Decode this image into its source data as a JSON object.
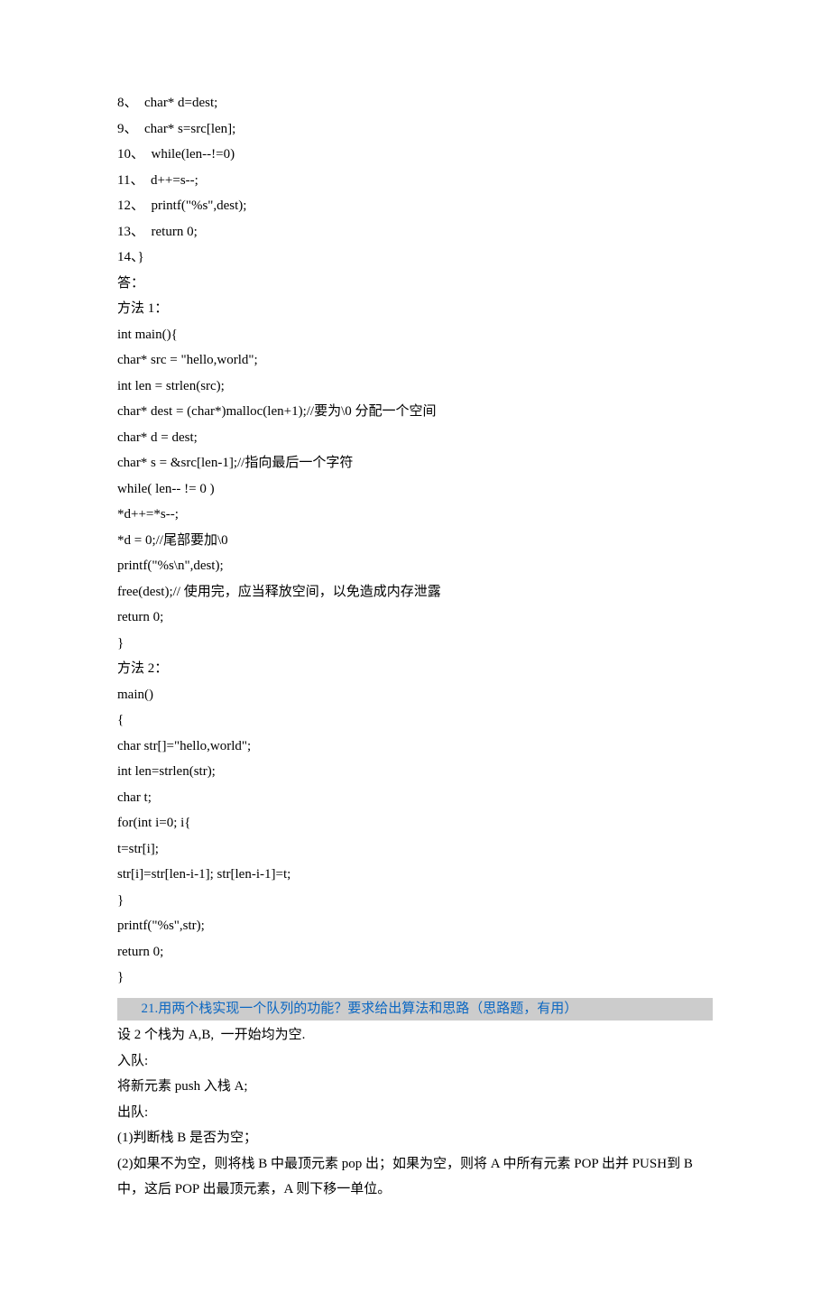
{
  "lines": [
    "8、  char* d=dest;",
    "9、  char* s=src[len];",
    "10、  while(len--!=0)",
    "11、  d++=s--;",
    "12、  printf(\"%s\",dest);",
    "13、  return 0;",
    "14、}",
    "答：",
    "方法 1：",
    "int main(){",
    "char* src = \"hello,world\";",
    "int len = strlen(src);",
    "char* dest = (char*)malloc(len+1);//要为\\0 分配一个空间",
    "char* d = dest;",
    "char* s = &src[len-1];//指向最后一个字符",
    "while( len-- != 0 )",
    "*d++=*s--;",
    "*d = 0;//尾部要加\\0",
    "printf(\"%s\\n\",dest);",
    "free(dest);// 使用完，应当释放空间，以免造成内存泄露",
    "return 0;",
    "}",
    "方法 2：",
    "main()",
    "{",
    "char str[]=\"hello,world\";",
    "int len=strlen(str);",
    "char t;",
    "for(int i=0; i{",
    "t=str[i];",
    "str[i]=str[len-i-1]; str[len-i-1]=t;",
    "}",
    "printf(\"%s\",str);",
    "return 0;",
    "}"
  ],
  "heading": "21.用两个栈实现一个队列的功能？要求给出算法和思路（思路题，有用）",
  "after": [
    "设 2 个栈为 A,B,  一开始均为空.",
    "入队:",
    "将新元素 push 入栈 A;",
    "出队:",
    "(1)判断栈 B 是否为空；",
    "(2)如果不为空，则将栈 B 中最顶元素 pop 出；如果为空，则将 A 中所有元素 POP 出并 PUSH到 B 中，这后 POP 出最顶元素，A 则下移一单位。"
  ]
}
